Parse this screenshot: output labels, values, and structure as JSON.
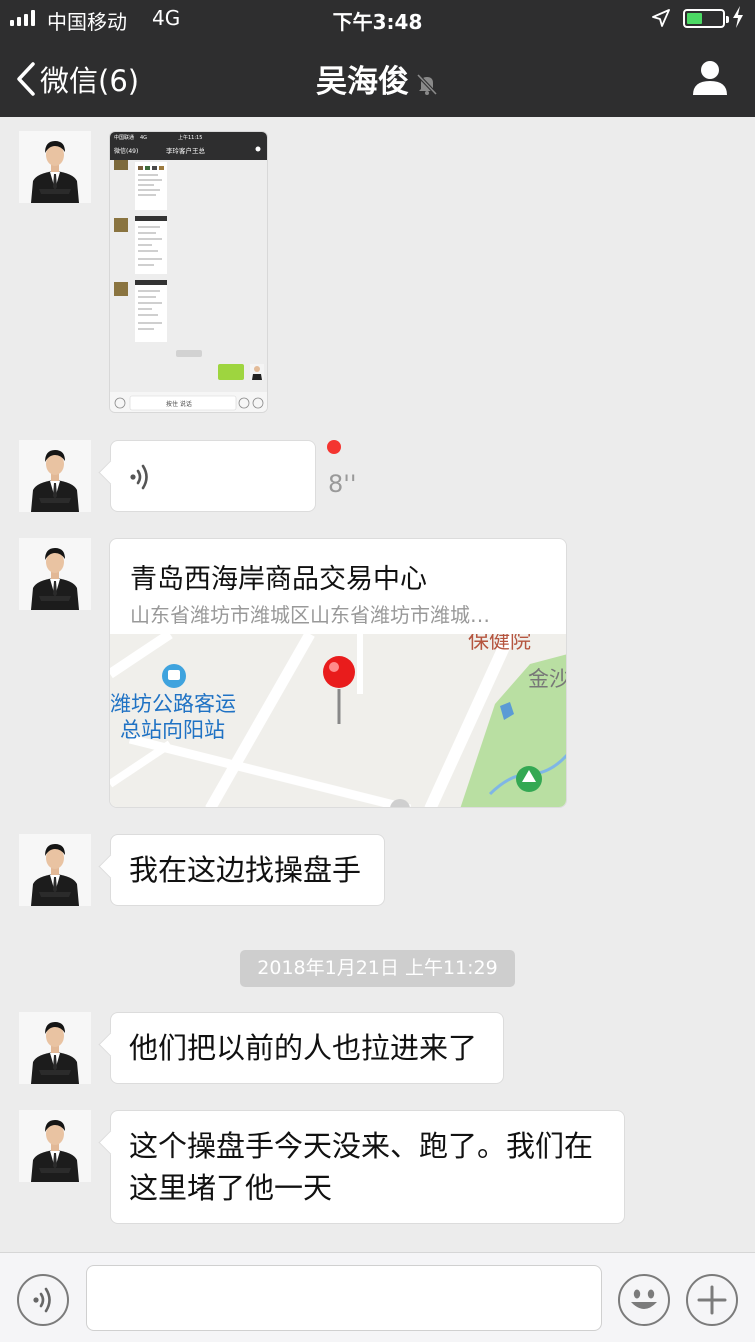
{
  "status_bar": {
    "carrier": "中国移动",
    "network": "4G",
    "time": "下午3:48",
    "battery_level": 0.45
  },
  "nav": {
    "back_label": "微信(6)",
    "title": "吴海俊",
    "muted": true
  },
  "messages": [
    {
      "type": "image",
      "thumb": {
        "carrier": "中国联通",
        "network": "4G",
        "time": "上午11:15",
        "back_label": "微信(49)",
        "title": "李玲客户王总",
        "input_label": "按住 说话"
      }
    },
    {
      "type": "voice",
      "duration": "8''",
      "unread": true
    },
    {
      "type": "location",
      "name": "青岛西海岸商品交易中心",
      "address": "山东省潍坊市潍城区山东省潍坊市潍城…",
      "map_labels": [
        "保健院",
        "金沙",
        "潍坊公路客运",
        "总站向阳站"
      ]
    },
    {
      "type": "text",
      "text": "我在这边找操盘手"
    }
  ],
  "timestamp": "2018年1月21日 上午11:29",
  "messages_after": [
    {
      "type": "text",
      "text": "他们把以前的人也拉进来了"
    },
    {
      "type": "text",
      "text": "这个操盘手今天没来、跑了。我们在这里堵了他一天"
    }
  ],
  "input_bar": {
    "voice_icon": "voice-mode-icon",
    "emoji_icon": "emoji-icon",
    "more_icon": "plus-icon",
    "text_value": ""
  }
}
